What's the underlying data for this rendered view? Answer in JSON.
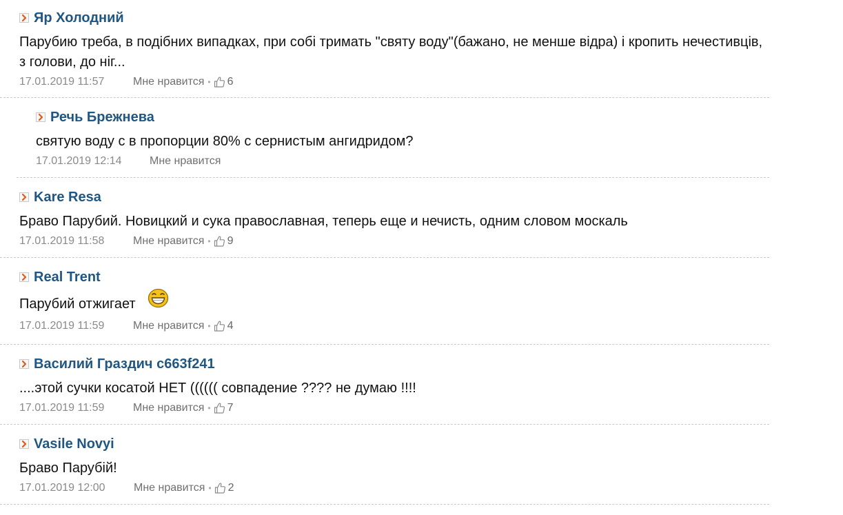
{
  "like_label": "Мне нравится",
  "comments": [
    {
      "author": "Яр Холодний",
      "text": "Парубию треба, в подібних випадках, при собі тримать \"святу воду\"(бажано, не менше відра) і кропить нечестивців, з голови, до ніг...",
      "date": "17.01.2019 11:57",
      "likes": "6",
      "level": 0
    },
    {
      "author": "Речь Брежнева",
      "text": "святую воду с в пропорции 80% с сернистым ангидридом?",
      "date": "17.01.2019 12:14",
      "likes": "",
      "level": 1
    },
    {
      "author": "Kare Resa",
      "text": "Браво Парубий. Новицкий и сука православная, теперь еще и нечисть, одним словом москаль",
      "date": "17.01.2019 11:58",
      "likes": "9",
      "level": 0
    },
    {
      "author": "Real Trent",
      "text": "Парубий отжигает",
      "date": "17.01.2019 11:59",
      "likes": "4",
      "level": 0,
      "emoticon": "grinning-smiley-icon"
    },
    {
      "author": "Василий Граздич c663f241",
      "text": "....этой сучки косатой НЕТ (((((( совпадение ???? не думаю !!!!",
      "date": "17.01.2019 11:59",
      "likes": "7",
      "level": 0
    },
    {
      "author": "Vasile Novyi",
      "text": "Браво Парубій!",
      "date": "17.01.2019 12:00",
      "likes": "2",
      "level": 0
    }
  ],
  "colors": {
    "author": "#1f5682",
    "text": "#111111",
    "meta": "#8a8a8a",
    "icon_arrow": "#e05a1c"
  }
}
